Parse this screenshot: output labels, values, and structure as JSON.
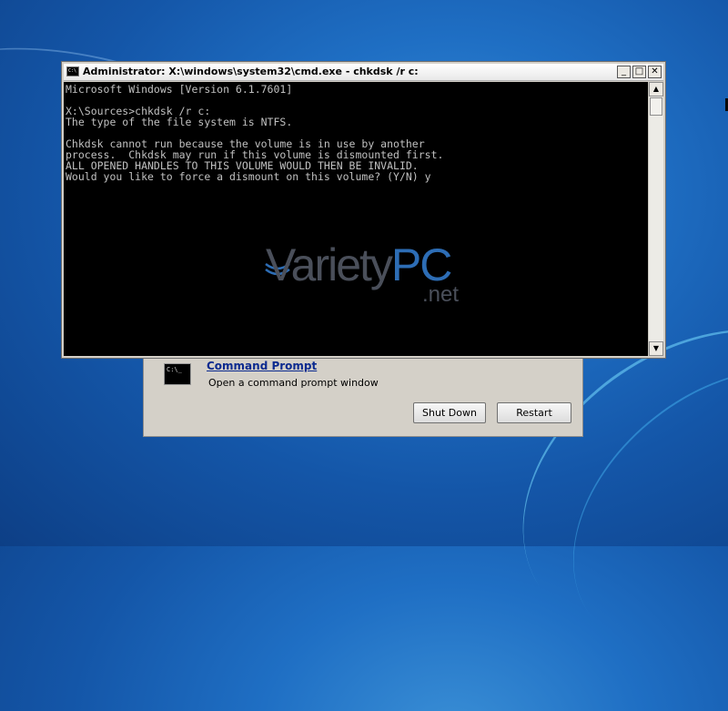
{
  "console": {
    "title": "Administrator: X:\\windows\\system32\\cmd.exe - chkdsk  /r c:",
    "icon": "cmd-icon",
    "icon_text": "C:\\",
    "controls": {
      "minimize": "_",
      "maximize": "□",
      "close": "✕"
    },
    "output": "Microsoft Windows [Version 6.1.7601]\n\nX:\\Sources>chkdsk /r c:\nThe type of the file system is NTFS.\n\nChkdsk cannot run because the volume is in use by another\nprocess.  Chkdsk may run if this volume is dismounted first.\nALL OPENED HANDLES TO THIS VOLUME WOULD THEN BE INVALID.\nWould you like to force a dismount on this volume? (Y/N) y",
    "scroll_up": "▲",
    "scroll_down": "▼"
  },
  "watermark": {
    "brand_variety": "Variety",
    "brand_pc": "PC",
    "brand_net": ".net"
  },
  "recovery": {
    "item_icon_text": "C:\\_",
    "item_title": "Command Prompt",
    "item_description": "Open a command prompt window",
    "shutdown_label": "Shut Down",
    "restart_label": "Restart"
  },
  "colors": {
    "console_text": "#c0c0c0",
    "console_bg": "#000000",
    "link": "#0b2a8f",
    "desktop": "#1f6fc4"
  }
}
